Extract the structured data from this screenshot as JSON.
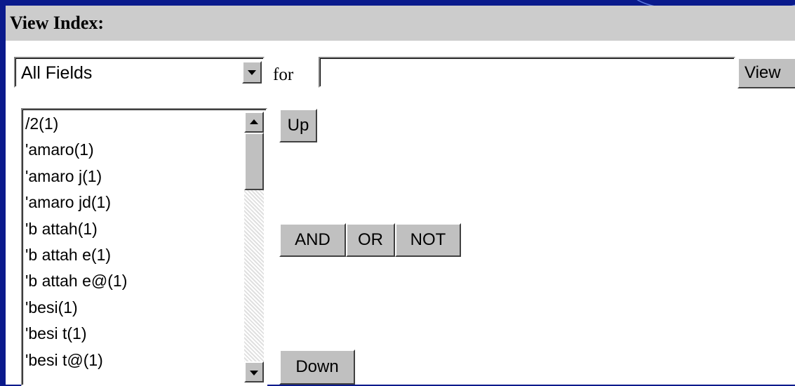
{
  "header": {
    "title": "View Index:"
  },
  "field_select": {
    "selected": "All Fields"
  },
  "for_label": "for",
  "search": {
    "value": "",
    "placeholder": ""
  },
  "buttons": {
    "view": "View",
    "up": "Up",
    "and": "AND",
    "or": "OR",
    "not": "NOT",
    "down": "Down"
  },
  "index_list": {
    "items": [
      "/2(1)",
      "'amaro(1)",
      "'amaro j(1)",
      "'amaro jd(1)",
      "'b attah(1)",
      "'b attah e(1)",
      "'b attah e@(1)",
      "'besi(1)",
      "'besi t(1)",
      "'besi t@(1)"
    ]
  },
  "colors": {
    "background": "#0a1a8c",
    "header_bar": "#cccccc",
    "button_face": "#c0c0c0"
  },
  "icons": [
    "chevron-down-icon",
    "scroll-up-icon",
    "scroll-down-icon"
  ]
}
